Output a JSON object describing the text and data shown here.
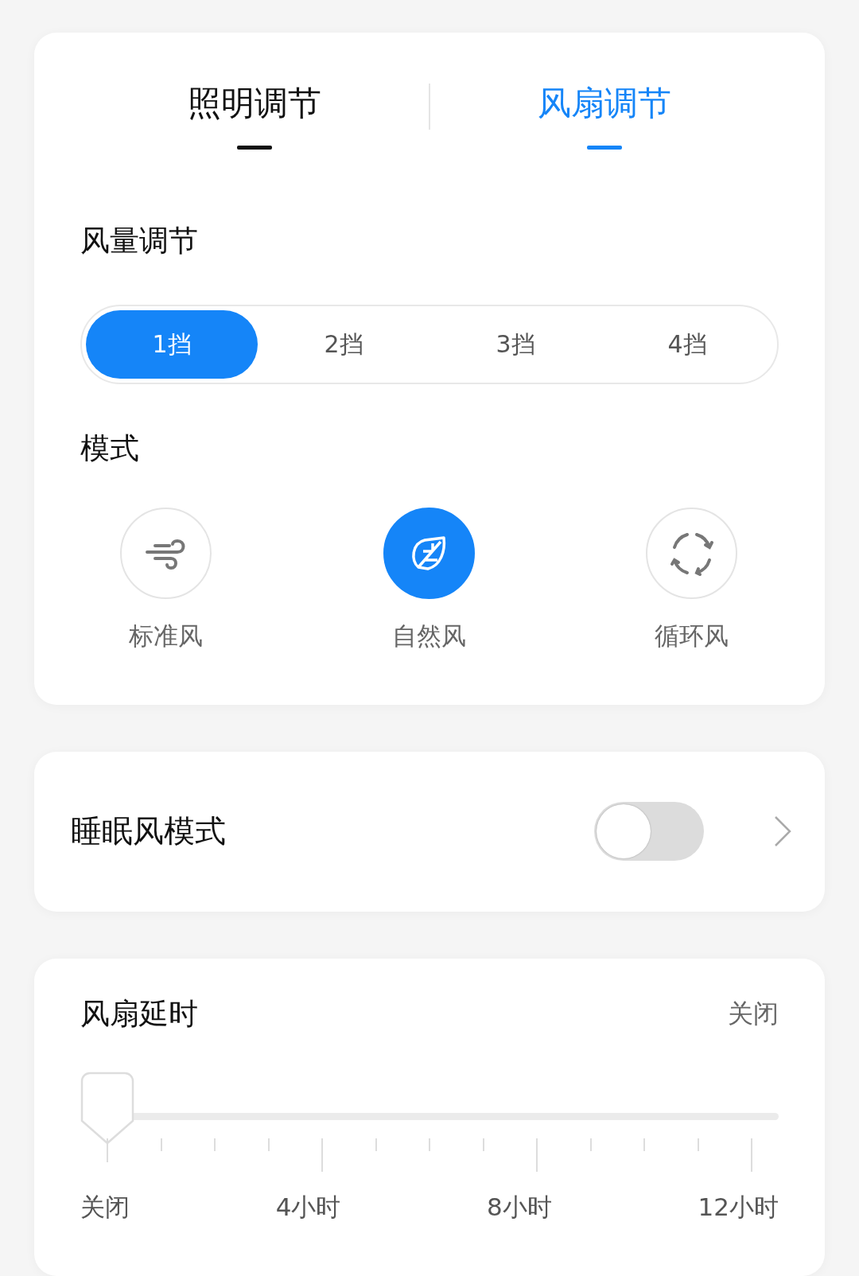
{
  "tabs": [
    {
      "label": "照明调节",
      "selected": false
    },
    {
      "label": "风扇调节",
      "selected": true
    }
  ],
  "fan_speed": {
    "title": "风量调节",
    "options": [
      {
        "label": "1挡",
        "selected": true
      },
      {
        "label": "2挡",
        "selected": false
      },
      {
        "label": "3挡",
        "selected": false
      },
      {
        "label": "4挡",
        "selected": false
      }
    ]
  },
  "mode": {
    "title": "模式",
    "options": [
      {
        "label": "标准风",
        "selected": false
      },
      {
        "label": "自然风",
        "selected": true
      },
      {
        "label": "循环风",
        "selected": false
      }
    ]
  },
  "sleep_mode": {
    "label": "睡眠风模式",
    "on": false
  },
  "delay": {
    "title": "风扇延时",
    "value": "关闭",
    "level": 0,
    "labels": [
      "关闭",
      "4小时",
      "8小时",
      "12小时"
    ]
  }
}
